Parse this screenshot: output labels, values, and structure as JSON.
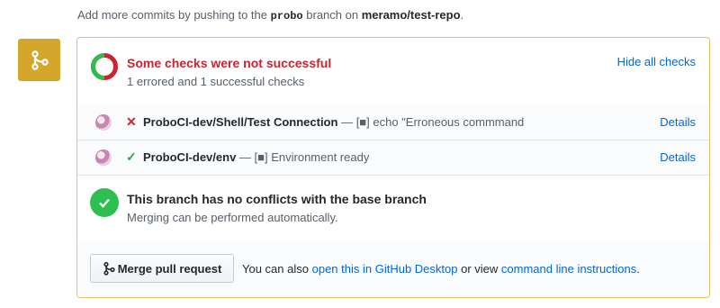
{
  "hint": {
    "prefix": "Add more commits by pushing to the",
    "branch": "probo",
    "middle": "branch on",
    "repo": "meramo/test-repo",
    "suffix": "."
  },
  "icons": {
    "merge_badge": "git-merge-icon",
    "summary": "checks-status-ring-icon",
    "conflicts_ok": "check-circle-icon",
    "merge_button": "git-merge-icon"
  },
  "summary": {
    "title": "Some checks were not successful",
    "subtitle": "1 errored and 1 successful checks",
    "hide_link": "Hide all checks"
  },
  "checks": [
    {
      "status_icon": "✕",
      "name": "ProboCI-dev/Shell/Test Connection",
      "description": "— [■] echo \"Erroneous commmand",
      "details": "Details"
    },
    {
      "status_icon": "✓",
      "name": "ProboCI-dev/env",
      "description": "— [■] Environment ready",
      "details": "Details"
    }
  ],
  "conflicts": {
    "title": "This branch has no conflicts with the base branch",
    "subtitle": "Merging can be performed automatically."
  },
  "merge": {
    "button_label": "Merge pull request",
    "text_before": "You can also",
    "desktop_link": "open this in GitHub Desktop",
    "text_middle": "or view",
    "cli_link": "command line instructions",
    "text_after": "."
  },
  "colors": {
    "badge": "#d4a72c",
    "panel_border": "#e1c16a",
    "error": "#cb2431",
    "success": "#2cbe4e",
    "link": "#0366d6"
  }
}
